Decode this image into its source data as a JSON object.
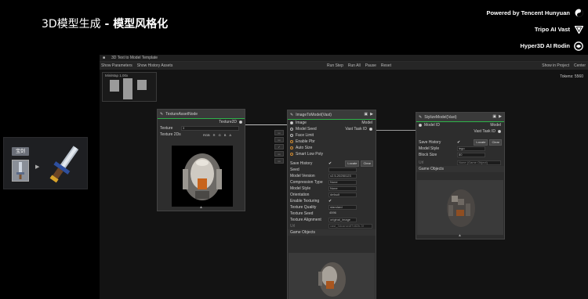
{
  "slide": {
    "title_prefix": "3D模型生成",
    "title_suffix": " - 模型风格化"
  },
  "credits": [
    {
      "label": "Powered by Tencent Hunyuan",
      "icon": "hunyuan-logo"
    },
    {
      "label": "Tripo AI Vast",
      "icon": "tripo-logo"
    },
    {
      "label": "Hyper3D AI Rodin",
      "icon": "rodin-logo"
    }
  ],
  "side_card": {
    "tag": "宝剑"
  },
  "editor": {
    "window_title": "3D Text to Model Template",
    "toolbar": {
      "show_parameters": "Show Parameters",
      "show_history": "Show History Assets",
      "run_step": "Run Step",
      "run_all": "Run All",
      "pause": "Pause",
      "reset": "Reset",
      "show_in_project": "Show in Project",
      "center": "Center"
    },
    "tokens": "Tokens: 5560",
    "minimap": {
      "label": "MiniMap  1.00x"
    }
  },
  "texture_node": {
    "title": "TextureAssetNode",
    "output": "Texture2D",
    "texture_label": "Texture",
    "texture_value": "3",
    "texture_2ds": "Texture 2Ds",
    "tabs": [
      "RGB",
      "R",
      "G",
      "B",
      "A"
    ]
  },
  "image_node": {
    "title": "ImageToModel(Vast)",
    "inputs": [
      "Image",
      "Model Seed",
      "Face Limit",
      "Enable Pbr",
      "Auto Size",
      "Smart Low Poly"
    ],
    "outputs": [
      "Model",
      "Vast Task ID"
    ],
    "save_history": "Save History",
    "locate": "Locate",
    "clear": "Clear",
    "params": [
      {
        "label": "Seed",
        "value": ""
      },
      {
        "label": "Model Version",
        "value": "v2.5-20250123"
      },
      {
        "label": "Compression Type",
        "value": "None"
      },
      {
        "label": "Model Style",
        "value": "None"
      },
      {
        "label": "Orientation",
        "value": "default"
      },
      {
        "label": "Enable Texturing",
        "value": "✔"
      },
      {
        "label": "Texture Quality",
        "value": "standard"
      },
      {
        "label": "Texture Seed",
        "value": "4596"
      },
      {
        "label": "Texture Alignment",
        "value": "original_image"
      }
    ],
    "url_label": "Url",
    "url_value": "vast_3dcarsedf7d82b.3f",
    "game_objects": "Game Objects"
  },
  "stylize_node": {
    "title": "StylizeModel(Vast)",
    "inputs": [
      "Model ID"
    ],
    "outputs": [
      "Model",
      "Vast Task ID"
    ],
    "save_history": "Save History",
    "locate": "Locate",
    "clear": "Clear",
    "params": [
      {
        "label": "Model Style",
        "value": "lego"
      },
      {
        "label": "Block Size",
        "value": "80"
      }
    ],
    "url_label": "Url",
    "url_value": "None (Game Object)",
    "game_objects": "Game Objects"
  },
  "colors": {
    "accent_green": "#2fb34a",
    "node_bg": "#2d2d2d",
    "canvas_bg": "#131313"
  }
}
